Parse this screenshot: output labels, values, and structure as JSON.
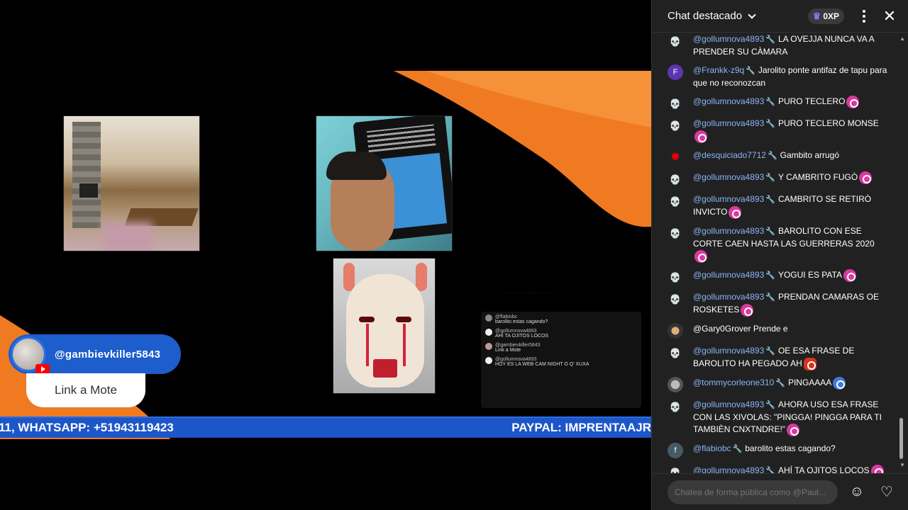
{
  "video": {
    "badge_user": "@gambievkiller5843",
    "badge_button": "Link a Mote",
    "ticker_left": "11, WHATSAPP: +51943119423",
    "ticker_right": "PAYPAL: IMPRENTAAJR",
    "mini_chat": [
      {
        "name": "@flabiobc",
        "text": "barolito estas cagando?"
      },
      {
        "name": "@gollumnova4893",
        "text": "AHÍ TA OJITOS LOCOS"
      },
      {
        "name": "@gambievkiller5843",
        "text": "Link a Mote"
      },
      {
        "name": "@gollumnova4893",
        "text": "HOY ES LA WEB CAM NIGHT O Q' XUXA"
      }
    ]
  },
  "chat": {
    "title": "Chat destacado",
    "xp": "0XP",
    "input_placeholder": "Chatea de forma pública como @Paul...",
    "messages": [
      {
        "author": "@gollumnova4893",
        "text": "LA OVEJJA NUNCA VA A PRENDER SU CÀMARA",
        "avatar": "skull",
        "mod": true,
        "emote": ""
      },
      {
        "author": "@Frankk-z9q",
        "text": "Jarolito ponte antifaz de tapu para que no reconozcan",
        "avatar": "F",
        "mod": true,
        "emote": ""
      },
      {
        "author": "@gollumnova4893",
        "text": "PURO TECLERO",
        "avatar": "skull",
        "mod": true,
        "emote": "pink"
      },
      {
        "author": "@gollumnova4893",
        "text": "PURO TECLERO MONSE",
        "avatar": "skull",
        "mod": true,
        "emote": "pink"
      },
      {
        "author": "@desquiciado7712",
        "text": "Gambito arrugó",
        "avatar": "pic1",
        "mod": true,
        "emote": ""
      },
      {
        "author": "@gollumnova4893",
        "text": "Y CAMBRITO FUGÒ",
        "avatar": "skull",
        "mod": true,
        "emote": "pink"
      },
      {
        "author": "@gollumnova4893",
        "text": "CAMBRITO SE RETIRÒ INVICTO",
        "avatar": "skull",
        "mod": true,
        "emote": "pink"
      },
      {
        "author": "@gollumnova4893",
        "text": "BAROLITO CON ESE CORTE CAEN HASTA LAS GUERRERAS 2020",
        "avatar": "skull",
        "mod": true,
        "emote": "pink"
      },
      {
        "author": "@gollumnova4893",
        "text": "YOGUI ES PATA",
        "avatar": "skull",
        "mod": true,
        "emote": "pink"
      },
      {
        "author": "@gollumnova4893",
        "text": "PRENDAN CAMARAS OE ROSKETES",
        "avatar": "skull",
        "mod": true,
        "emote": "pink"
      },
      {
        "author": "@Gary0Grover",
        "text": "Prende e",
        "avatar": "pic2",
        "mod": false,
        "emote": ""
      },
      {
        "author": "@gollumnova4893",
        "text": "OE ESA FRASE DE BAROLITO HA PEGADO AH",
        "avatar": "skull",
        "mod": true,
        "emote": "red"
      },
      {
        "author": "@tommycorleone310",
        "text": "PINGAAAA",
        "avatar": "pic3",
        "mod": true,
        "emote": "blue"
      },
      {
        "author": "@gollumnova4893",
        "text": "AHORA USO ESA FRASE CON LAS XIVOLAS: \"PINGGA! PINGGA PARA TI TAMBIÈN CNXTNDRE!\"",
        "avatar": "skull",
        "mod": true,
        "emote": "pink"
      },
      {
        "author": "@flabiobc",
        "text": "barolito estas cagando?",
        "avatar": "f",
        "mod": true,
        "emote": ""
      },
      {
        "author": "@gollumnova4893",
        "text": "AHÍ TA OJITOS LOCOS",
        "avatar": "skull",
        "mod": true,
        "emote": "pink"
      },
      {
        "author": "@gollumnova4893",
        "text": "HOY ES LA WEB CAM NIGHT O Q' XUXA",
        "avatar": "skull",
        "mod": true,
        "emote": "pink"
      }
    ]
  },
  "colors": {
    "accent": "#8ab4f8",
    "ticker": "#1d56c8",
    "swoosh": "#f07a22"
  }
}
